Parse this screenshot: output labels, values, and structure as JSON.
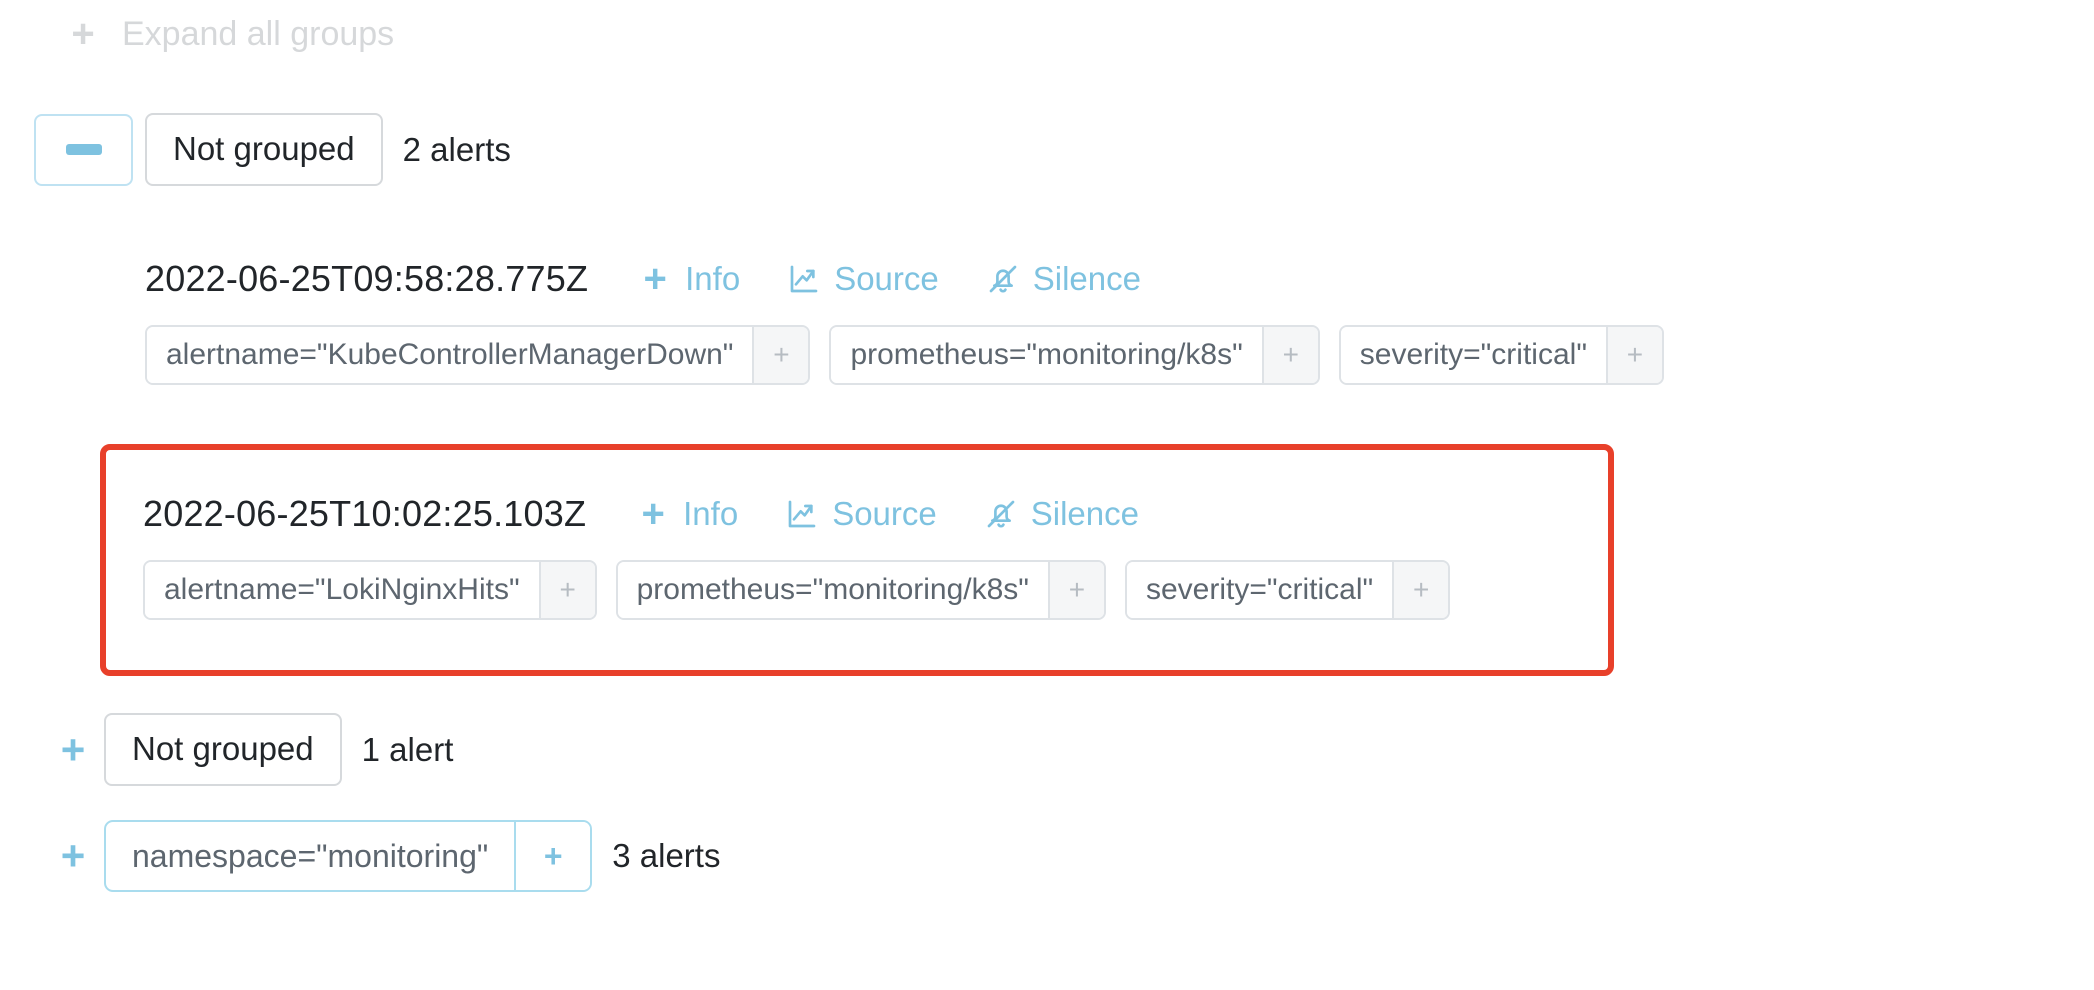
{
  "toolbar": {
    "expand_all_label": "Expand all groups",
    "expand_all_icon": "plus-icon",
    "plus_glyph": "+"
  },
  "colors": {
    "accent_blue": "#7ec2e0",
    "chip_border_blue": "#a9dcee",
    "chip_border_gray": "#dee2e6",
    "highlight_red": "#e8402a",
    "muted_text": "#d6d8da",
    "label_text": "#5d666f"
  },
  "groups": [
    {
      "toggle_icon": "minus-icon",
      "toggle_glyph": "−",
      "expanded": true,
      "name": "Not grouped",
      "count_label": "2 alerts",
      "alerts": [
        {
          "timestamp": "2022-06-25T09:58:28.775Z",
          "actions": [
            {
              "icon": "plus-icon",
              "label": "Info"
            },
            {
              "icon": "chart-line-icon",
              "label": "Source"
            },
            {
              "icon": "bell-slash-icon",
              "label": "Silence"
            }
          ],
          "labels": [
            {
              "text": "alertname=\"KubeControllerManagerDown\"",
              "add_glyph": "+"
            },
            {
              "text": "prometheus=\"monitoring/k8s\"",
              "add_glyph": "+"
            },
            {
              "text": "severity=\"critical\"",
              "add_glyph": "+"
            }
          ]
        },
        {
          "timestamp": "2022-06-25T10:02:25.103Z",
          "highlighted": true,
          "actions": [
            {
              "icon": "plus-icon",
              "label": "Info"
            },
            {
              "icon": "chart-line-icon",
              "label": "Source"
            },
            {
              "icon": "bell-slash-icon",
              "label": "Silence"
            }
          ],
          "labels": [
            {
              "text": "alertname=\"LokiNginxHits\"",
              "add_glyph": "+"
            },
            {
              "text": "prometheus=\"monitoring/k8s\"",
              "add_glyph": "+"
            },
            {
              "text": "severity=\"critical\"",
              "add_glyph": "+"
            }
          ]
        }
      ]
    },
    {
      "toggle_icon": "plus-icon",
      "toggle_glyph": "+",
      "expanded": false,
      "name": "Not grouped",
      "count_label": "1 alert"
    },
    {
      "toggle_icon": "plus-icon",
      "toggle_glyph": "+",
      "expanded": false,
      "chip": {
        "text": "namespace=\"monitoring\"",
        "add_glyph": "+"
      },
      "count_label": "3 alerts"
    }
  ]
}
